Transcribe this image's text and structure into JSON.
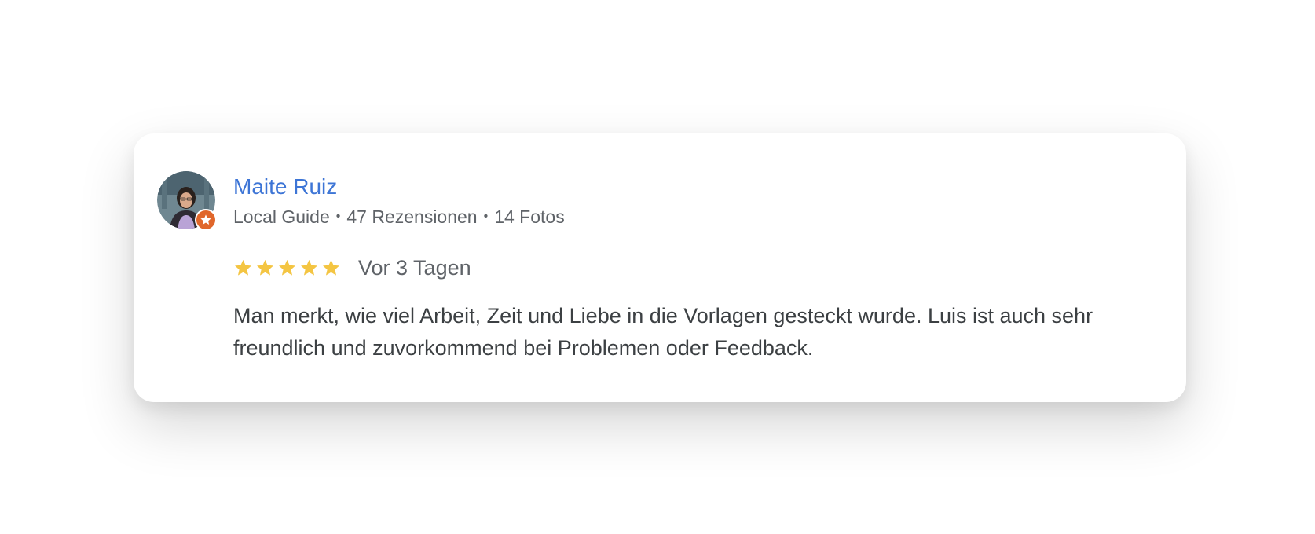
{
  "review": {
    "author": {
      "name": "Maite Ruiz",
      "badge": "Local Guide",
      "reviews": "47 Rezensionen",
      "photos": "14 Fotos",
      "separator": "•",
      "avatar_icon": "user-avatar",
      "badge_icon": "local-guide-star-icon"
    },
    "rating": 5,
    "rating_max": 5,
    "date": "Vor 3 Tagen",
    "text": "Man merkt, wie viel Arbeit, Zeit und Liebe in die Vorlagen gesteckt wurde. Luis ist auch sehr freundlich und zuvorkommend bei Problemen oder Feedback."
  },
  "colors": {
    "author_link": "#3d75d6",
    "star": "#f4c542",
    "badge": "#e0662a",
    "meta_text": "#5f6368",
    "body_text": "#3c4043"
  }
}
